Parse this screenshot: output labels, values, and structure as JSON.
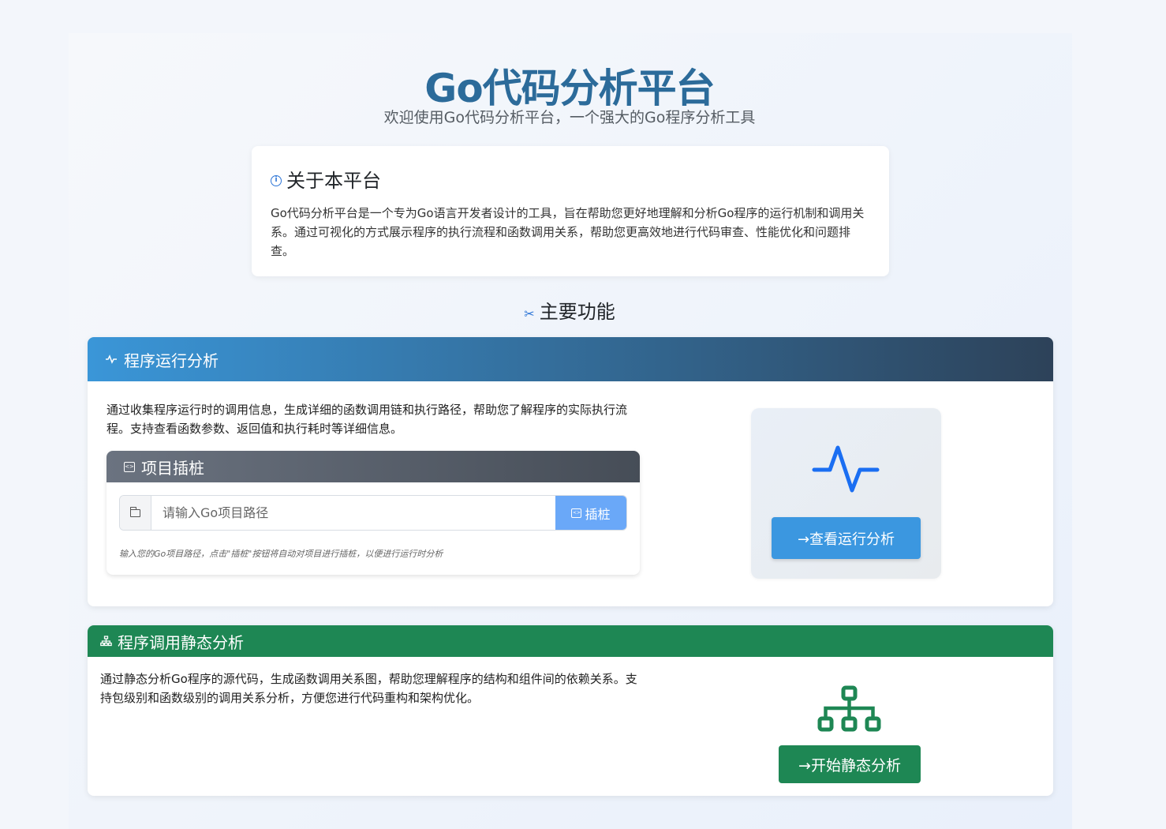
{
  "header": {
    "title": "Go代码分析平台",
    "subtitle": "欢迎使用Go代码分析平台，一个强大的Go程序分析工具"
  },
  "about": {
    "icon": "info-icon",
    "title": "关于本平台",
    "text": "Go代码分析平台是一个专为Go语言开发者设计的工具，旨在帮助您更好地理解和分析Go程序的运行机制和调用关系。通过可视化的方式展示程序的执行流程和函数调用关系，帮助您更高效地进行代码审查、性能优化和问题排查。"
  },
  "features": {
    "icon": "tools-icon",
    "title": "主要功能"
  },
  "runtime": {
    "icon": "pulse-icon",
    "title": "程序运行分析",
    "description": "通过收集程序运行时的调用信息，生成详细的函数调用链和执行路径，帮助您了解程序的实际执行流程。支持查看函数参数、返回值和执行耗时等详细信息。",
    "instrument": {
      "icon": "code-square-icon",
      "title": "项目插桩",
      "input_placeholder": "请输入Go项目路径",
      "input_value": "",
      "button_label": "插桩",
      "hint": "输入您的Go项目路径，点击\"插桩\"按钮将自动对项目进行插桩，以便进行运行时分析"
    },
    "button_label": "→查看运行分析",
    "accent_color": "#3b97e0"
  },
  "static": {
    "icon": "diagram-icon",
    "title": "程序调用静态分析",
    "description": "通过静态分析Go程序的源代码，生成函数调用关系图，帮助您理解程序的结构和组件间的依赖关系。支持包级别和函数级别的调用关系分析，方便您进行代码重构和架构优化。",
    "button_label": "→开始静态分析",
    "accent_color": "#1e8754"
  }
}
